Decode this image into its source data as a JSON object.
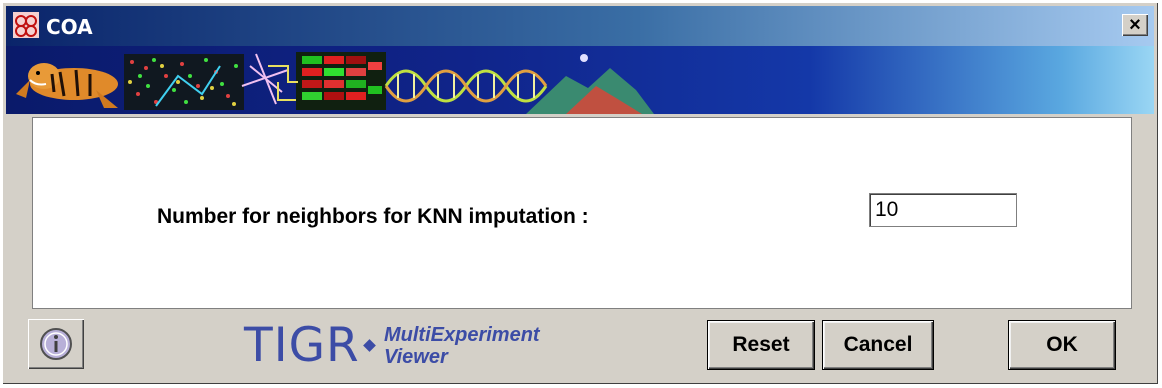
{
  "window": {
    "title": "COA",
    "close_glyph": "×"
  },
  "form": {
    "label": "Number for neighbors for KNN imputation :",
    "value": "10"
  },
  "footer": {
    "logo_main": "TIGR",
    "logo_sub_line1": "MultiExperiment",
    "logo_sub_line2": "Viewer",
    "info_icon": "info-icon",
    "buttons": {
      "reset": "Reset",
      "cancel": "Cancel",
      "ok": "OK"
    }
  },
  "colors": {
    "titlebar_start": "#0a246a",
    "titlebar_end": "#a6caf0",
    "logo": "#3c4ca6",
    "face": "#d4d0c8"
  }
}
